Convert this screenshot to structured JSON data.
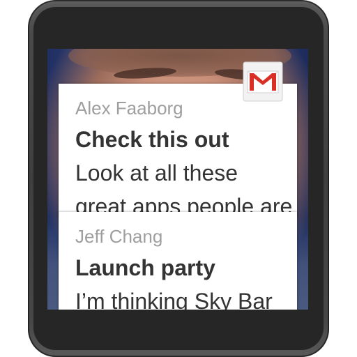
{
  "app": {
    "icon": "gmail-icon",
    "accent_color": "#d93025"
  },
  "notifications": [
    {
      "sender": "Alex Faaborg",
      "subject": "Check this out",
      "snippet_lines": [
        "Look at all these",
        "great apps people are"
      ]
    },
    {
      "sender": "Jeff Chang",
      "subject": "Launch party",
      "snippet_lines": [
        "I’m thinking Sky Bar"
      ]
    }
  ],
  "colors": {
    "card_background": "#ffffff",
    "sender_text": "#9e9e9e",
    "body_text": "#333333",
    "watch_body": "#4a4a4a",
    "background_photo": "#2a3a70"
  }
}
